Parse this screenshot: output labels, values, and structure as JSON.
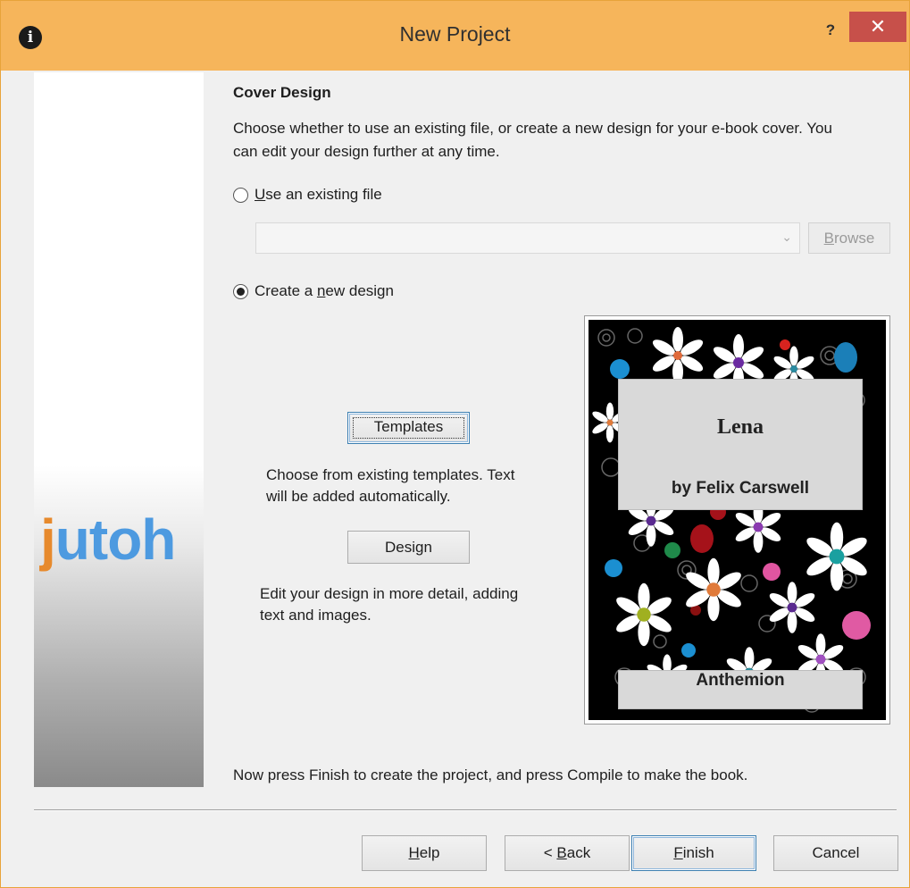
{
  "window": {
    "title": "New Project",
    "help_label": "?",
    "close_label": "✕",
    "app_icon_glyph": "i"
  },
  "sidebar": {
    "logo_first": "j",
    "logo_rest": "utoh"
  },
  "page": {
    "section_title": "Cover Design",
    "intro": "Choose whether to use an existing file, or create a new design for your e-book cover. You can edit your design further at any time.",
    "option_existing": {
      "mnemonic": "U",
      "label_rest": "se an existing file",
      "checked": false
    },
    "file_combo": {
      "value": "",
      "arrow": "⌄"
    },
    "browse": {
      "mnemonic": "B",
      "label_rest": "rowse",
      "enabled": false
    },
    "option_new": {
      "label_before": "Create a ",
      "mnemonic": "n",
      "label_after": "ew design",
      "checked": true
    },
    "templates_button": "Templates",
    "templates_desc_line1": "Choose from existing templates. Text",
    "templates_desc_line2": "will be added automatically.",
    "design_button": "Design",
    "design_desc_line1": "Edit your design in more detail, adding",
    "design_desc_line2": "text and images.",
    "finish_note": "Now press Finish to create the project, and press Compile to make the book."
  },
  "cover": {
    "title": "Lena",
    "author": "by Felix Carswell",
    "publisher": "Anthemion"
  },
  "footer": {
    "help": {
      "mnemonic": "H",
      "rest": "elp"
    },
    "back": {
      "prefix": "< ",
      "mnemonic": "B",
      "rest": "ack"
    },
    "finish": {
      "mnemonic": "F",
      "rest": "inish"
    },
    "cancel": "Cancel"
  },
  "colors": {
    "titlebar": "#f6b55b",
    "close": "#c7504a",
    "logo_orange": "#e78a2d",
    "logo_blue": "#4d9ae0",
    "focus_border": "#3c7fb1"
  },
  "icons": [
    "app-icon",
    "help-icon",
    "close-icon",
    "chevron-down-icon",
    "radio-icon"
  ]
}
